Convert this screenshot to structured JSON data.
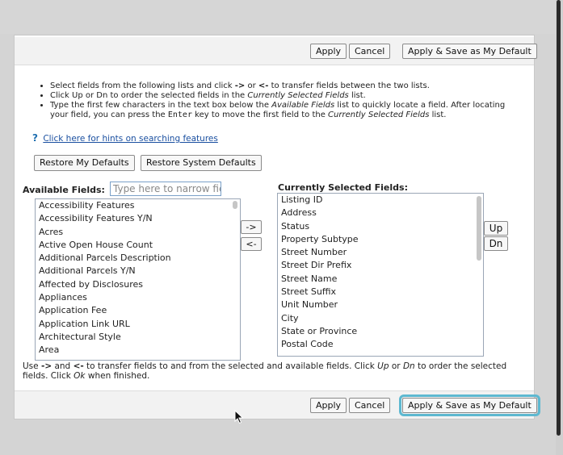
{
  "toolbar_top": {
    "apply": "Apply",
    "cancel": "Cancel",
    "save_default": "Apply & Save as My Default"
  },
  "toolbar_bottom": {
    "apply": "Apply",
    "cancel": "Cancel",
    "save_default": "Apply & Save as My Default"
  },
  "instructions": {
    "line1": {
      "a": "Select fields from the following lists and click ",
      "arrow_r": "->",
      "b": " or ",
      "arrow_l": "<-",
      "c": " to transfer fields between the two lists."
    },
    "line2": {
      "a": "Click Up or Dn to order the selected fields in the ",
      "em": "Currently Selected Fields",
      "b": " list."
    },
    "line3": {
      "a": "Type the first few characters in the text box below the ",
      "em1": "Available Fields",
      "b": " list to quickly locate a field. After locating your field, you can press the ",
      "key": "Enter",
      "c": " key to move the first field to the ",
      "em2": "Currently Selected Fields",
      "d": " list."
    }
  },
  "hint": {
    "icon": "?",
    "text": "Click here for hints on searching features"
  },
  "restore": {
    "my_defaults": "Restore My Defaults",
    "system_defaults": "Restore System Defaults"
  },
  "available": {
    "label": "Available Fields:",
    "filter_placeholder": "Type here to narrow fielc",
    "items": [
      "Accessibility Features",
      "Accessibility Features Y/N",
      "Acres",
      "Active Open House Count",
      "Additional Parcels Description",
      "Additional Parcels Y/N",
      "Affected by Disclosures",
      "Appliances",
      "Application Fee",
      "Application Link URL",
      "Architectural Style",
      "Area"
    ]
  },
  "transfer": {
    "right": "->",
    "left": "<-"
  },
  "selected": {
    "label": "Currently Selected Fields:",
    "items": [
      "Listing ID",
      "Address",
      "Status",
      "Property Subtype",
      "Street Number",
      "Street Dir Prefix",
      "Street Name",
      "Street Suffix",
      "Unit Number",
      "City",
      "State or Province",
      "Postal Code"
    ]
  },
  "order": {
    "up": "Up",
    "down": "Dn"
  },
  "footer": {
    "a": "Use ",
    "r": "->",
    "b": " and ",
    "l": "<-",
    "c": " to transfer fields to and from the selected and available fields. Click ",
    "up": "Up",
    "d": " or ",
    "dn": "Dn",
    "e": " to order the selected fields. Click ",
    "ok": "Ok",
    "f": " when finished."
  },
  "colors": {
    "focus_outline": "#5db8d0",
    "link": "#1a4fa0",
    "hint_icon": "#1f6fb0"
  }
}
